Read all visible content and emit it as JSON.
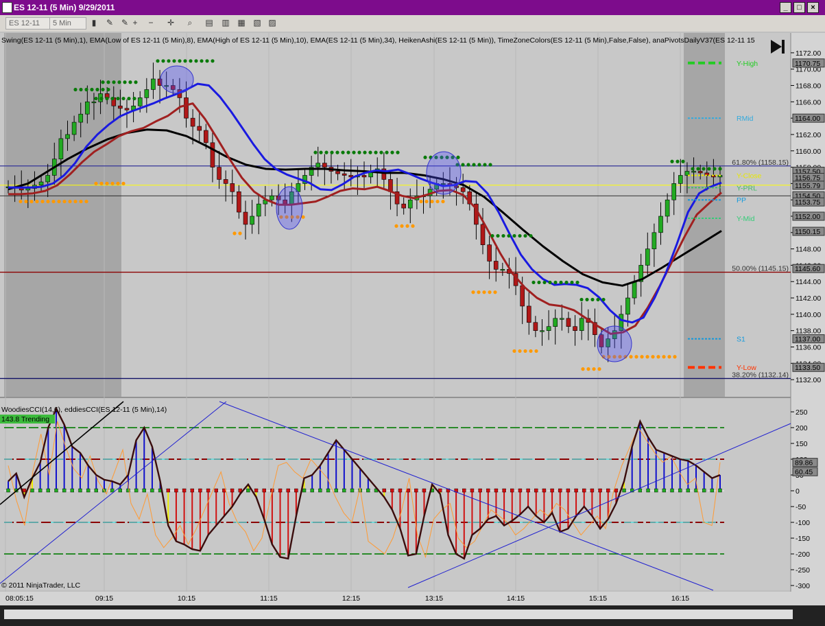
{
  "window": {
    "title": "ES 12-11 (5 Min)  9/29/2011"
  },
  "toolbar": {
    "instrument": "ES 12-11",
    "interval": "5 Min"
  },
  "colors": {
    "titlebar": "#7d0c8c",
    "up_candle": "#22aa22",
    "down_candle": "#b01818",
    "ema_fast": "#1a1ae0",
    "ema_slow": "#a02020",
    "ema_34": "#000000",
    "swing_high": "#0a7a0a",
    "swing_low": "#ff9900"
  },
  "price_panel": {
    "header": "Swing(ES 12-11 (5 Min),1), EMA(Low of ES 12-11 (5 Min),8), EMA(High of ES 12-11 (5 Min),10), EMA(ES 12-11 (5 Min),34), HeikenAshi(ES 12-11 (5 Min)), TimeZoneColors(ES 12-11 (5 Min),False,False), anaPivotsDailyV37(ES 12-11 15",
    "price_ticks": [
      "1172.00",
      "1170.00",
      "1168.00",
      "1166.00",
      "1164.00",
      "1162.00",
      "1160.00",
      "1158.00",
      "1156.00",
      "1154.00",
      "1152.00",
      "1150.00",
      "1148.00",
      "1146.00",
      "1144.00",
      "1142.00",
      "1140.00",
      "1138.00",
      "1136.00",
      "1134.00",
      "1132.00"
    ],
    "pivot_labels": [
      {
        "text": "Y-High",
        "price": 1170.75,
        "color": "#22cc22"
      },
      {
        "text": "RMid",
        "price": 1164.0,
        "color": "#33aadd"
      },
      {
        "text": "Y-Close",
        "price": 1157.0,
        "color": "#e8e800"
      },
      {
        "text": "Y-PRL",
        "price": 1155.5,
        "color": "#44bb66"
      },
      {
        "text": "PP",
        "price": 1154.0,
        "color": "#1199dd"
      },
      {
        "text": "Y-Mid",
        "price": 1151.75,
        "color": "#33cc77"
      },
      {
        "text": "S1",
        "price": 1137.0,
        "color": "#1199dd"
      },
      {
        "text": "Y-Low",
        "price": 1133.5,
        "color": "#ff3300"
      }
    ],
    "fib_labels": [
      {
        "text": "61.80% (1158.15)",
        "price": 1158.15
      },
      {
        "text": "50.00% (1145.15)",
        "price": 1145.15
      },
      {
        "text": "38.20% (1132.14)",
        "price": 1132.14
      }
    ],
    "price_flags": [
      "1170.75",
      "1164.00",
      "1157.50",
      "1156.75",
      "1155.79",
      "1154.50",
      "1153.75",
      "1152.00",
      "1150.15",
      "1145.60",
      "1137.00",
      "1133.50"
    ]
  },
  "cci_panel": {
    "header": "WoodiesCCI(14,6), eddiesCCI(ES 12-11 (5 Min),14)",
    "badge": "143.8 Trending",
    "ticks": [
      "250",
      "200",
      "150",
      "100",
      "50",
      "0",
      "-50",
      "-100",
      "-150",
      "-200",
      "-250",
      "-300"
    ],
    "flags": [
      "89.86",
      "60.45"
    ],
    "copyright": "© 2011 NinjaTrader, LLC"
  },
  "time_axis": [
    "08:05:15",
    "09:15",
    "10:15",
    "11:15",
    "12:15",
    "13:15",
    "14:15",
    "15:15",
    "16:15"
  ],
  "chart_data": {
    "type": "line",
    "title": "ES 12-11 (5 Min) 9/29/2011",
    "ylim": [
      1131,
      1173
    ],
    "x_ticks": [
      "08:05:15",
      "09:15",
      "10:15",
      "11:15",
      "12:15",
      "13:15",
      "14:15",
      "15:15",
      "16:15"
    ],
    "closes": [
      1155.6,
      1155.6,
      1155.2,
      1155.4,
      1155.8,
      1156.2,
      1157,
      1159,
      1161.5,
      1162,
      1163.5,
      1164.5,
      1166,
      1166,
      1167,
      1166.5,
      1165.5,
      1165.2,
      1165,
      1165.5,
      1166.5,
      1167.5,
      1168.8,
      1168,
      1168,
      1167.5,
      1166.5,
      1164,
      1163,
      1162.5,
      1161,
      1158,
      1156.5,
      1156,
      1155,
      1152.5,
      1151,
      1152,
      1153.5,
      1154,
      1154.5,
      1154,
      1153.5,
      1155,
      1156,
      1157,
      1158,
      1158.5,
      1158,
      1157.5,
      1157.2,
      1157,
      1156.8,
      1157,
      1156.8,
      1157.5,
      1157.8,
      1156.5,
      1155,
      1153.5,
      1153,
      1154,
      1154.5,
      1154.5,
      1155.3,
      1156,
      1156,
      1155.7,
      1155.5,
      1155,
      1153.5,
      1151,
      1148.5,
      1146.5,
      1145.5,
      1145.5,
      1145,
      1143.5,
      1141,
      1139,
      1138,
      1138,
      1138.5,
      1139.5,
      1139.5,
      1138.5,
      1138,
      1139.5,
      1139,
      1137.5,
      1136,
      1137,
      1138,
      1140,
      1142,
      1144,
      1146,
      1148,
      1150,
      1152,
      1154,
      1156,
      1157,
      1157.5,
      1157.5,
      1157.3,
      1157,
      1156.8,
      1157
    ],
    "ema_fast": [
      1155.5,
      1155.5,
      1155.5,
      1155.6,
      1156,
      1157,
      1158.5,
      1160.5,
      1162,
      1163.2,
      1164.2,
      1164.8,
      1165.3,
      1165.8,
      1166.4,
      1166.9,
      1167.5,
      1168.2,
      1168,
      1166.6,
      1164.8,
      1162.8,
      1160.8,
      1159,
      1157.8,
      1157.1,
      1156.6,
      1156.1,
      1155.3,
      1155.2,
      1155.9,
      1156.8,
      1157.3,
      1157.6,
      1157.5,
      1157.7,
      1157.2,
      1156.6,
      1156.1,
      1155.7,
      1155.8,
      1156.3,
      1156.2,
      1154.8,
      1152.5,
      1149.8,
      1147.3,
      1145.5,
      1144.3,
      1143.6,
      1143.7,
      1143.6,
      1143.2,
      1142.1,
      1140.5,
      1139.3,
      1139,
      1139.6,
      1142,
      1145,
      1148.6,
      1152.5,
      1154.8,
      1155.6,
      1156.1
    ],
    "ema_slow": [
      1154.7,
      1154.7,
      1154.8,
      1155.1,
      1155.8,
      1157.1,
      1158.6,
      1159.9,
      1160.8,
      1161.8,
      1162.4,
      1162.8,
      1163.6,
      1164.3,
      1165.4,
      1165.8,
      1163.9,
      1161.5,
      1159,
      1156.7,
      1155,
      1154,
      1153.4,
      1153.4,
      1153.6,
      1153.8,
      1154.4,
      1155.1,
      1155.4,
      1155.3,
      1155.6,
      1155.1,
      1154.5,
      1154.2,
      1154.6,
      1155.1,
      1155.2,
      1154.6,
      1153,
      1150.3,
      1147.5,
      1145,
      1143.3,
      1142,
      1141.2,
      1141,
      1140.5,
      1139.5,
      1138.5,
      1137.6,
      1137.8,
      1138.6,
      1140.8,
      1143.5,
      1146.5,
      1149.5,
      1152.2,
      1153.6,
      1154.9
    ],
    "ema_34": [
      1155.3,
      1156,
      1157.5,
      1159,
      1160.3,
      1161.4,
      1162.2,
      1162.6,
      1162.5,
      1161.8,
      1160.6,
      1159.3,
      1158.3,
      1157.8,
      1157.7,
      1157.8,
      1157.8,
      1157.6,
      1157.5,
      1157.3,
      1157.3,
      1157,
      1156.5,
      1155.8,
      1154.4,
      1152.4,
      1150.3,
      1148.3,
      1146.5,
      1144.9,
      1143.9,
      1143.5,
      1144.3,
      1145.7,
      1147.2,
      1148.7,
      1150.2
    ],
    "swing_highs": [
      1171,
      1167.5,
      1166.4,
      1168.4,
      1159.8,
      1159.2,
      1158.3,
      1149.6,
      1143.9,
      1141.8,
      1158.7,
      1157.8
    ],
    "swing_lows": [
      1153.8,
      1156,
      1149.9,
      1151.9,
      1150.8,
      1153.8,
      1142.7,
      1135.5,
      1133.3,
      1134.8
    ],
    "cci": [
      30,
      55,
      -20,
      40,
      90,
      200,
      260,
      210,
      140,
      120,
      80,
      50,
      35,
      30,
      20,
      50,
      160,
      200,
      140,
      30,
      -110,
      -160,
      -170,
      -185,
      -190,
      -140,
      -110,
      -80,
      -50,
      -10,
      20,
      -20,
      -90,
      -170,
      -210,
      -215,
      -80,
      40,
      50,
      80,
      120,
      160,
      130,
      100,
      70,
      40,
      10,
      -20,
      -60,
      -120,
      -205,
      -200,
      -80,
      20,
      -10,
      -140,
      -200,
      -215,
      -140,
      -120,
      -90,
      -80,
      -110,
      -95,
      -75,
      -50,
      -80,
      -100,
      -70,
      -130,
      -120,
      -80,
      -50,
      -80,
      -120,
      -90,
      -40,
      30,
      140,
      220,
      170,
      130,
      120,
      110,
      100,
      95,
      80,
      60,
      40,
      50
    ],
    "turbo_cci": [
      80,
      -30,
      -110,
      60,
      180,
      50,
      220,
      140,
      70,
      40,
      110,
      30,
      -10,
      60,
      130,
      -40,
      -90,
      -10,
      -140,
      -180,
      -150,
      -110,
      -170,
      -120,
      -60,
      0,
      60,
      -40,
      -100,
      -130,
      -190,
      -150,
      -30,
      80,
      90,
      60,
      40,
      100,
      70,
      40,
      -20,
      -70,
      -100,
      10,
      -160,
      -180,
      -200,
      -150,
      -70,
      40,
      -140,
      -210,
      -90,
      -60,
      -40,
      -150,
      -180,
      -160,
      -110,
      -60,
      -80,
      -100,
      -140,
      -120,
      -90,
      -60,
      -80,
      -40,
      -60,
      -100,
      -140,
      -110,
      -80,
      -120,
      0,
      80,
      140,
      200,
      160,
      120,
      90,
      110,
      60,
      20,
      40,
      -100,
      -110,
      90
    ],
    "series": [
      {
        "name": "EMA(High of ES 12-11 (5 Min),10)",
        "values": "ema_fast"
      },
      {
        "name": "EMA(Low of ES 12-11 (5 Min),8)",
        "values": "ema_slow"
      },
      {
        "name": "EMA(ES 12-11 (5 Min),34)",
        "values": "ema_34"
      }
    ]
  }
}
